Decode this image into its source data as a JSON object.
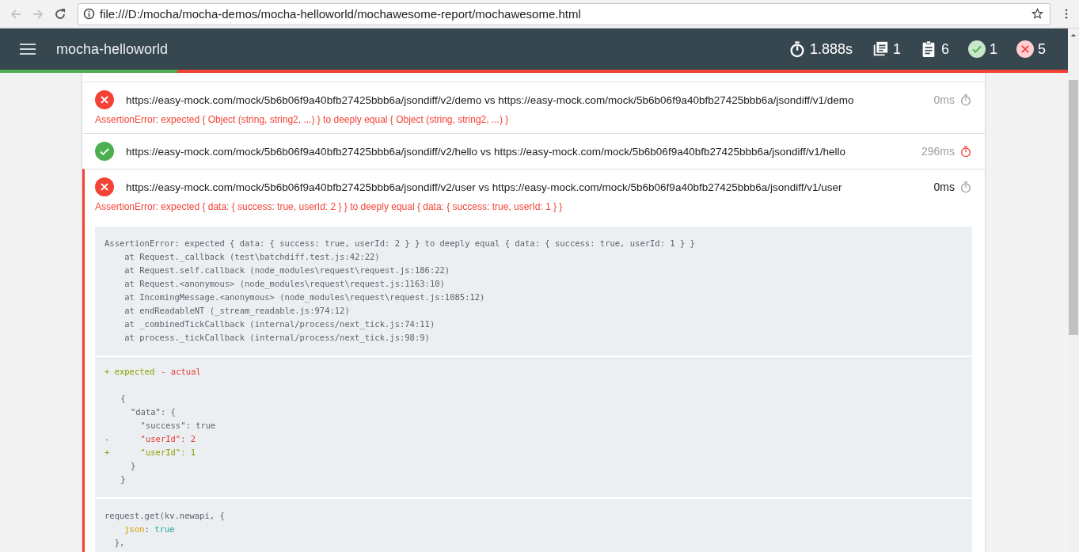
{
  "browser": {
    "back_disabled": true,
    "forward_disabled": true,
    "address": "file:///D:/mocha/mocha-demos/mocha-helloworld/mochawesome-report/mochawesome.html"
  },
  "header": {
    "title": "mocha-helloworld",
    "stats": [
      {
        "kind": "duration",
        "value": "1.888s"
      },
      {
        "kind": "suites",
        "value": "1"
      },
      {
        "kind": "tests",
        "value": "6"
      },
      {
        "kind": "passes",
        "value": "1"
      },
      {
        "kind": "failures",
        "value": "5"
      }
    ],
    "pass_bar": {
      "level": 0.166
    }
  },
  "tests": [
    {
      "passed": false,
      "expanded": false,
      "slow": false,
      "title": "https://easy-mock.com/mock/5b6b06f9a40bfb27425bbb6a/jsondiff/v2/demo vs https://easy-mock.com/mock/5b6b06f9a40bfb27425bbb6a/jsondiff/v1/demo",
      "duration": "0ms",
      "error": "AssertionError: expected { Object (string, string2, ...) } to deeply equal { Object (string, string2, ...) }"
    },
    {
      "passed": true,
      "expanded": false,
      "slow": true,
      "title": "https://easy-mock.com/mock/5b6b06f9a40bfb27425bbb6a/jsondiff/v2/hello vs https://easy-mock.com/mock/5b6b06f9a40bfb27425bbb6a/jsondiff/v1/hello",
      "duration": "296ms"
    },
    {
      "passed": false,
      "expanded": true,
      "slow": false,
      "title": "https://easy-mock.com/mock/5b6b06f9a40bfb27425bbb6a/jsondiff/v2/user vs https://easy-mock.com/mock/5b6b06f9a40bfb27425bbb6a/jsondiff/v1/user",
      "duration": "0ms",
      "error": "AssertionError: expected { data: { success: true, userId: 2 } } to deeply equal { data: { success: true, userId: 1 } }",
      "stack": [
        "AssertionError: expected { data: { success: true, userId: 2 } } to deeply equal { data: { success: true, userId: 1 } }",
        "    at Request._callback (test\\batchdiff.test.js:42:22)",
        "    at Request.self.callback (node_modules\\request\\request.js:186:22)",
        "    at Request.<anonymous> (node_modules\\request\\request.js:1163:10)",
        "    at IncomingMessage.<anonymous> (node_modules\\request\\request.js:1085:12)",
        "    at endReadableNT (_stream_readable.js:974:12)",
        "    at _combinedTickCallback (internal/process/next_tick.js:74:11)",
        "    at process._tickCallback (internal/process/next_tick.js:98:9)"
      ],
      "diff_legend": {
        "expected": "+ expected",
        "actual": "- actual"
      },
      "diff": [
        {
          "kind": "plain",
          "text": " {"
        },
        {
          "kind": "plain",
          "text": "   \"data\": {"
        },
        {
          "kind": "plain",
          "text": "     \"success\": true"
        },
        {
          "kind": "removed",
          "sign": "-",
          "text": "     \"userId\": 2"
        },
        {
          "kind": "added",
          "sign": "+",
          "text": "     \"userId\": 1"
        },
        {
          "kind": "plain",
          "text": "   }"
        },
        {
          "kind": "plain",
          "text": " }"
        }
      ],
      "code": [
        [
          {
            "kind": "plain",
            "text": "request.get(kv.newapi, {"
          }
        ],
        [
          {
            "kind": "attr",
            "text": "    json"
          },
          {
            "kind": "plain",
            "text": ": "
          },
          {
            "kind": "literal",
            "text": "true"
          }
        ],
        [
          {
            "kind": "plain",
            "text": "  },"
          }
        ]
      ]
    }
  ]
}
